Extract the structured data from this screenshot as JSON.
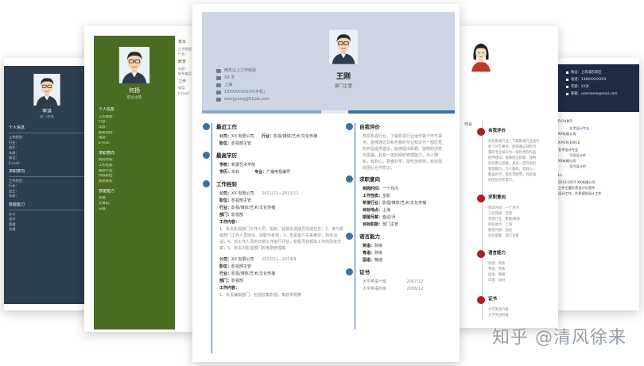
{
  "card_left_dark": {
    "name": "李洪",
    "title": "部门总监",
    "sections": [
      "个人信息",
      "求职意向",
      "技能能力"
    ],
    "rows": [
      "工作经验：",
      "行业：",
      "出生：",
      "年龄：",
      "电话：",
      "E-mail："
    ],
    "skill_rows": [
      "办公",
      "设计",
      "管理",
      "沟通"
    ]
  },
  "card_green": {
    "name": "何扬",
    "title": "职业主管",
    "sections": [
      "个人信息",
      "求职意向",
      "技能能力"
    ],
    "rows": [
      "工作经验：",
      "行业：",
      "年龄：",
      "联系电话：",
      "电话：",
      "E-mail："
    ],
    "intent_rows": [
      "到岗时间：",
      "工作性质：",
      "期望行业：",
      "目标职位：",
      "期望薪资："
    ],
    "skill_rows": [
      "英语：",
      "计算机：",
      "日语："
    ],
    "right_sections": [
      "基本",
      "教育",
      "工作"
    ]
  },
  "card_main": {
    "header_info": [
      "两年以上工作经验",
      "XX 岁",
      "上海",
      "13XXXXXXXXX(手机)",
      "wangyang@51job.com"
    ],
    "name": "王刚",
    "title": "部门主管",
    "left": {
      "s1": "最近工作",
      "s1_rows": [
        {
          "label": "公司：",
          "value": "XX 有限公司"
        },
        {
          "label": "行业：",
          "value": "影视/媒体/艺术/文化传播"
        },
        {
          "label": "职位：",
          "value": "影视部主管"
        }
      ],
      "s2": "最高学历",
      "s2_rows": [
        {
          "label": "学校：",
          "value": "新疆艺术学院"
        },
        {
          "label": "学历：",
          "value": "本科"
        },
        {
          "label": "专业：",
          "value": "广播电视编导"
        }
      ],
      "s3": "工作经验",
      "job1": [
        {
          "label": "公司：",
          "value": "XX 有限公司"
        },
        {
          "label": "",
          "value": "2011/11—2015/11"
        },
        {
          "label": "职位：",
          "value": "影视部主管"
        },
        {
          "label": "行业：",
          "value": "影视/媒体/艺术/文化传播"
        },
        {
          "label": "部门：",
          "value": "影视部"
        },
        {
          "label": "工作内容：",
          "value": ""
        }
      ],
      "job1_desc": "1、负责影视部门工作人员，组织、监督协调成员完成任务；2、参与影视部门工作人员培训、招聘与考核；3、负责客户关系维护，商务洽谈；4、对工作人员的日常工作进行评估，积极寻找相关工作的改进方案；5、负责对影视部门的考勤管理等。",
      "job2": [
        {
          "label": "公司：",
          "value": "XX 有限公司"
        },
        {
          "label": "",
          "value": "2013/11—2014/9"
        },
        {
          "label": "职位：",
          "value": "影视部主管"
        },
        {
          "label": "行业：",
          "value": "影视/媒体/艺术/文化传播"
        },
        {
          "label": "部门：",
          "value": "影视部"
        },
        {
          "label": "工作内容：",
          "value": ""
        }
      ],
      "job2_desc": "1、负责编辑部门，包括收集影视、策划专题等"
    },
    "right": {
      "s1": "自我评价",
      "s1_desc": "热爱影视行业，了解影视行业运作各个环节事务，能够通过日积月累的专业知识为一部优秀的作品提供建议，能够提出新颖、独特的创意与思路，具有一定的组织管理能力，为人随和，有耐心，勤奋好学，能吃苦耐劳，有较强的团队合作意识。",
      "s2": "求职意向",
      "s2_rows": [
        {
          "label": "到岗时间：",
          "value": "一个月内"
        },
        {
          "label": "工作性质：",
          "value": "全职"
        },
        {
          "label": "希望行业：",
          "value": "影视/媒体/艺术/文化传播"
        },
        {
          "label": "目标地点：",
          "value": "上海"
        },
        {
          "label": "期望月薪：",
          "value": "面议/月"
        },
        {
          "label": "目标职能：",
          "value": "部门主管"
        }
      ],
      "s3": "语言能力",
      "s3_rows": [
        {
          "label": "英语：",
          "value": "熟练"
        },
        {
          "label": "粤语：",
          "value": "熟练"
        },
        {
          "label": "国语：",
          "value": "精通"
        }
      ],
      "s4": "证书",
      "s4_rows": [
        {
          "label": "大学英语六级",
          "value": "2007/12"
        },
        {
          "label": "大学英语四级",
          "value": "2006/12"
        }
      ]
    }
  },
  "card_red": {
    "name": "何青",
    "sections": [
      "自我评价",
      "求职意向",
      "语言能力",
      "证书"
    ],
    "self_desc": [
      "热爱影视行业，了解影视行业运作",
      "各个环节事务，能够通过日积月",
      "累的专业知识为一部优秀的作品",
      "提供建议，能够提出新颖、独特",
      "的创意与思路，具有一定的组织",
      "管理能力，为人随和，有耐心，",
      "勤奋好学，能吃苦耐劳，有较强",
      "的团队合作意识。"
    ],
    "intent": [
      "到岗时间：一个月内",
      "工作性质：全职",
      "希望行业：影视/媒体",
      "目标地点：上海",
      "期望月薪：面议",
      "目标职能：部门主管"
    ],
    "lang": [
      "英语：熟练",
      "粤语：熟练",
      "国语：精通",
      "日语：良好"
    ],
    "cert": [
      "大学英语六级",
      "大学英语四级"
    ]
  },
  "card_right_navy": {
    "contact": [
      "地址：上海浦东新区",
      "电话：138XXXXXXXX",
      "年龄：XX岁",
      "邮箱：username@mail.com"
    ],
    "headings": [
      "ROUND",
      "XPERIENCE",
      "LL"
    ],
    "lines": [
      "XX有限公司",
      "艺术设计专业",
      "XX有限公司",
      "2013-2015 XX有限公司",
      "工作主要负责设计与宣传",
      "设计工作，负责视觉设计工作"
    ],
    "links": [
      "艺术设计专业",
      "平面设计师",
      "室内设计师"
    ]
  },
  "watermark": "知乎 @清风徐来"
}
